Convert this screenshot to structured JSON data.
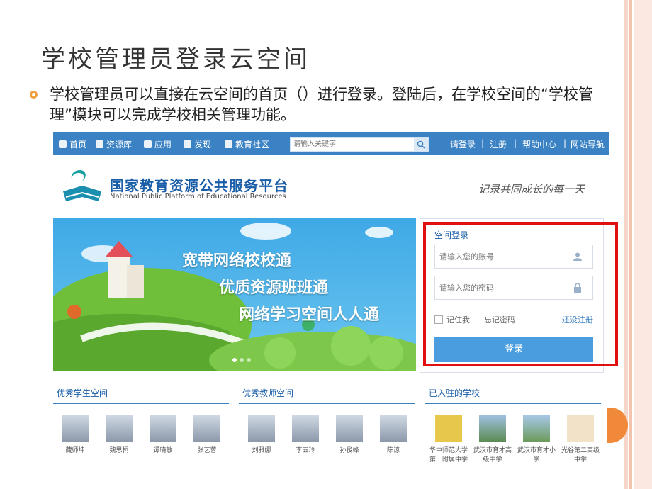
{
  "slide": {
    "title": "学校管理员登录云空间",
    "body": "学校管理员可以直接在云空间的首页（）进行登录。登陆后，在学校空间的“学校管理”模块可以完成学校相关管理功能。"
  },
  "navbar": {
    "items": [
      "首页",
      "资源库",
      "应用",
      "发现",
      "教育社区"
    ],
    "search_placeholder": "请输入关键字",
    "right_links": [
      "请登录",
      "|",
      "注册",
      "|",
      "帮助中心",
      "|",
      "网站导航"
    ]
  },
  "logo": {
    "cn": "国家教育资源公共服务平台",
    "en": "National Public Platform of Educational Resources"
  },
  "slogan": "记录共同成长的每一天",
  "banner": {
    "lines": [
      "宽带网络校校通",
      "优质资源班班通",
      "网络学习空间人人通"
    ]
  },
  "login": {
    "title": "空间登录",
    "account_placeholder": "请输入您的账号",
    "password_placeholder": "请输入您的密码",
    "remember": "记住我",
    "forgot": "忘记密码",
    "register": "还没注册",
    "button": "登录"
  },
  "sections": [
    {
      "title": "优秀学生空间",
      "people": [
        "藏师坤",
        "魏思桐",
        "谭晓敏",
        "张艺蓉"
      ]
    },
    {
      "title": "优秀教师空间",
      "people": [
        "刘雅娜",
        "李五玲",
        "孙俊峰",
        "陈谅"
      ]
    },
    {
      "title": "已入驻的学校",
      "people": [
        "华中师范大学第一附属中学",
        "武汉市育才高级中学",
        "武汉市育才小学",
        "光谷第二高级中学"
      ]
    }
  ],
  "colors": {
    "nav": "#3b82c4",
    "accent": "#4a9ee0",
    "highlight": "#e01010"
  }
}
